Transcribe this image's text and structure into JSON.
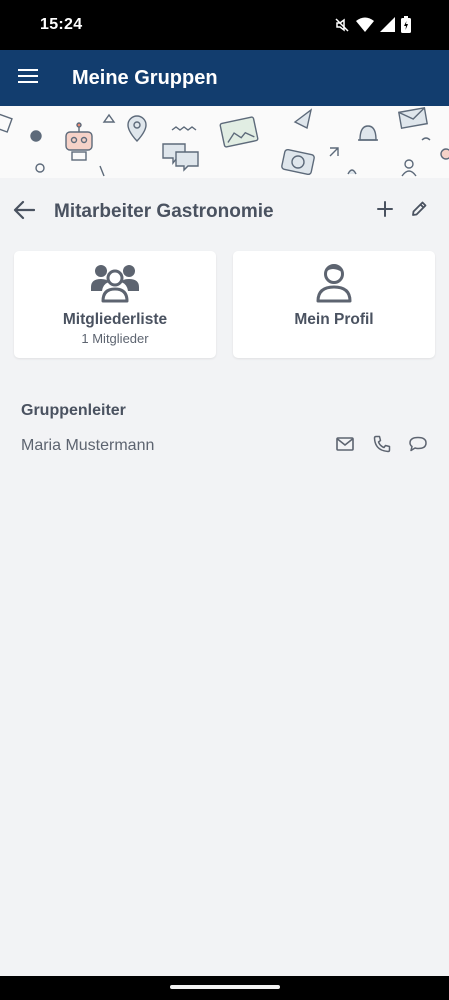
{
  "status_bar": {
    "time": "15:24",
    "icons": [
      "mute-icon",
      "wifi-icon",
      "signal-icon",
      "battery-icon"
    ]
  },
  "app_bar": {
    "title": "Meine Gruppen",
    "menu_icon": "hamburger-menu-icon",
    "background": "#123d6e"
  },
  "group": {
    "title": "Mitarbeiter Gastronomie",
    "back_icon": "arrow-back-icon",
    "add_icon": "plus-icon",
    "edit_icon": "pencil-icon"
  },
  "cards": {
    "members": {
      "title": "Mitgliederliste",
      "subtitle": "1 Mitglieder",
      "icon": "group-icon"
    },
    "profile": {
      "title": "Mein Profil",
      "icon": "person-icon"
    }
  },
  "leaders": {
    "heading": "Gruppenleiter",
    "items": [
      {
        "name": "Maria Mustermann",
        "actions": [
          "mail-icon",
          "phone-icon",
          "chat-icon"
        ]
      }
    ]
  },
  "colors": {
    "text_primary": "#4a5260",
    "page_background": "#f2f3f5",
    "card_background": "#ffffff"
  }
}
